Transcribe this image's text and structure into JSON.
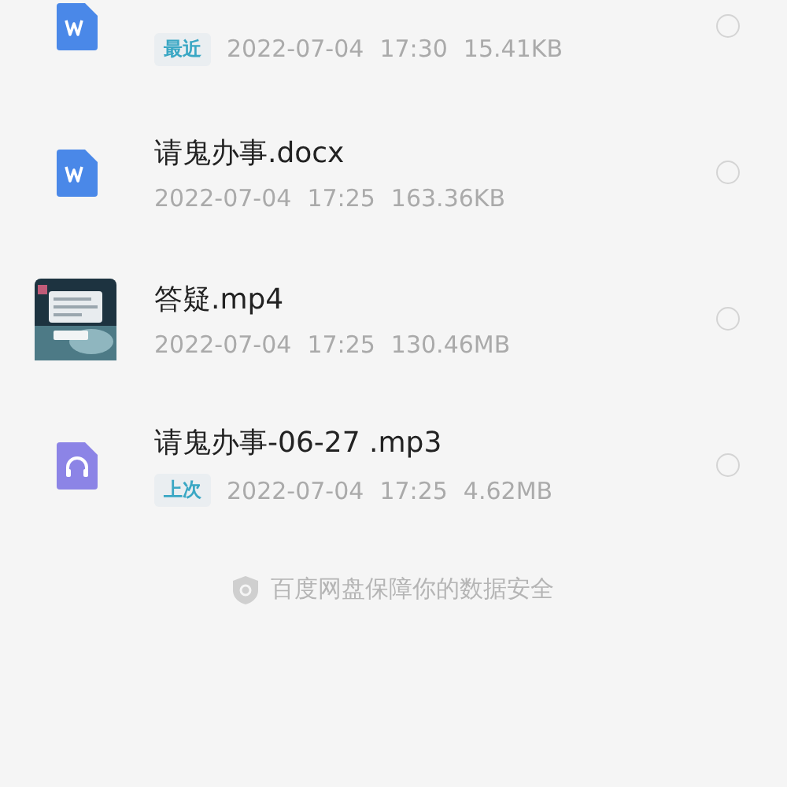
{
  "files": [
    {
      "kind": "doc",
      "tag": "最近",
      "date": "2022-07-04",
      "time": "17:30",
      "size": "15.41KB",
      "selected": false
    },
    {
      "kind": "doc",
      "name": "请鬼办事.docx",
      "date": "2022-07-04",
      "time": "17:25",
      "size": "163.36KB",
      "selected": false
    },
    {
      "kind": "video",
      "name": "答疑.mp4",
      "date": "2022-07-04",
      "time": "17:25",
      "size": "130.46MB",
      "selected": false
    },
    {
      "kind": "audio",
      "name": "请鬼办事-06-27 .mp3",
      "tag": "上次",
      "date": "2022-07-04",
      "time": "17:25",
      "size": "4.62MB",
      "selected": false
    }
  ],
  "footer": "百度网盘保障你的数据安全"
}
